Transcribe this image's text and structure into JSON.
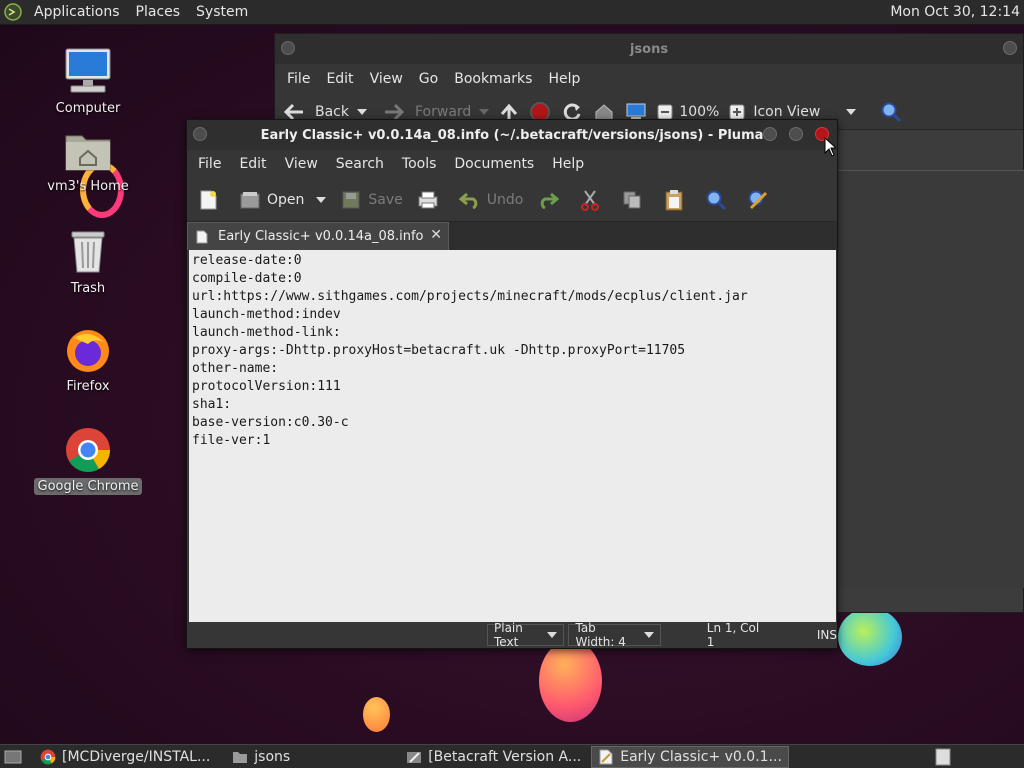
{
  "top_panel": {
    "menus": [
      "Applications",
      "Places",
      "System"
    ],
    "clock": "Mon Oct 30, 12:14"
  },
  "desktop_icons": [
    {
      "label": "Computer",
      "icon": "computer-icon"
    },
    {
      "label": "vm3's Home",
      "icon": "home-folder-icon"
    },
    {
      "label": "Trash",
      "icon": "trash-icon"
    },
    {
      "label": "Firefox",
      "icon": "firefox-icon"
    },
    {
      "label": "Google Chrome",
      "icon": "chrome-icon"
    }
  ],
  "file_manager": {
    "title": "jsons",
    "menus": [
      "File",
      "Edit",
      "View",
      "Go",
      "Bookmarks",
      "Help"
    ],
    "toolbar": {
      "back": "Back",
      "forward": "Forward",
      "zoom": "100%",
      "view_mode": "Icon View"
    }
  },
  "pluma": {
    "title": "Early Classic+ v0.0.14a_08.info (~/.betacraft/versions/jsons) - Pluma",
    "menus": [
      "File",
      "Edit",
      "View",
      "Search",
      "Tools",
      "Documents",
      "Help"
    ],
    "toolbar": {
      "open": "Open",
      "save": "Save",
      "undo": "Undo"
    },
    "tab_label": "Early Classic+ v0.0.14a_08.info",
    "lines": [
      "release-date:0",
      "compile-date:0",
      "url:https://www.sithgames.com/projects/minecraft/mods/ecplus/client.jar",
      "launch-method:indev",
      "launch-method-link:",
      "proxy-args:-Dhttp.proxyHost=betacraft.uk -Dhttp.proxyPort=11705",
      "other-name:",
      "protocolVersion:111",
      "sha1:",
      "base-version:c0.30-c",
      "file-ver:1"
    ],
    "status": {
      "language": "Plain Text",
      "tab_width": "Tab Width:  4",
      "position": "Ln 1, Col 1",
      "mode": "INS"
    }
  },
  "taskbar": {
    "items": [
      {
        "label": "[MCDiverge/INSTAL...",
        "icon": "chrome-icon",
        "active": false
      },
      {
        "label": "jsons",
        "icon": "folder-icon",
        "active": false
      },
      {
        "label": "[Betacraft Version A...",
        "icon": "editor-icon",
        "active": false
      },
      {
        "label": "Early Classic+ v0.0.1...",
        "icon": "pluma-icon",
        "active": true
      }
    ]
  },
  "colors": {
    "panel": "#2b2b2b",
    "window": "#363636",
    "editor_bg": "#ececec",
    "close_button": "#b2161a"
  }
}
